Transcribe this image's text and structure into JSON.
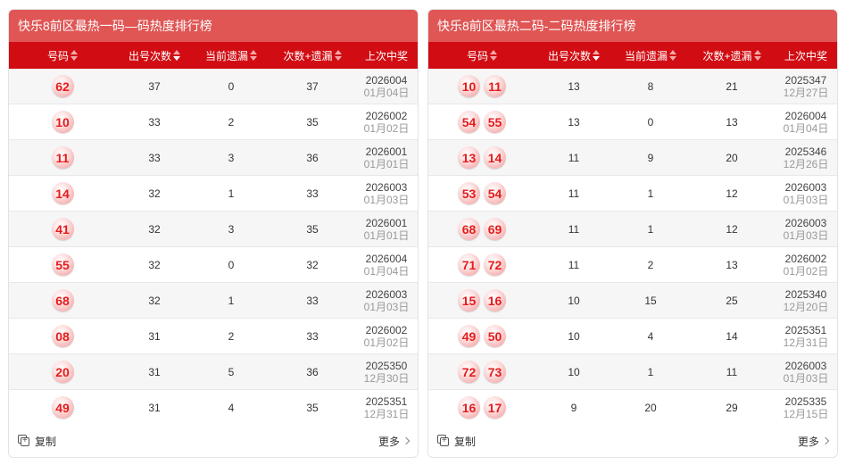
{
  "panels": [
    {
      "title": "快乐8前区最热一码—码热度排行榜",
      "headers": {
        "number": "号码",
        "count": "出号次数",
        "miss": "当前遗漏",
        "sum": "次数+遗漏",
        "last": "上次中奖"
      },
      "rows": [
        {
          "balls": [
            "62"
          ],
          "count": "37",
          "miss": "0",
          "sum": "37",
          "period": "2026004",
          "date": "01月04日"
        },
        {
          "balls": [
            "10"
          ],
          "count": "33",
          "miss": "2",
          "sum": "35",
          "period": "2026002",
          "date": "01月02日"
        },
        {
          "balls": [
            "11"
          ],
          "count": "33",
          "miss": "3",
          "sum": "36",
          "period": "2026001",
          "date": "01月01日"
        },
        {
          "balls": [
            "14"
          ],
          "count": "32",
          "miss": "1",
          "sum": "33",
          "period": "2026003",
          "date": "01月03日"
        },
        {
          "balls": [
            "41"
          ],
          "count": "32",
          "miss": "3",
          "sum": "35",
          "period": "2026001",
          "date": "01月01日"
        },
        {
          "balls": [
            "55"
          ],
          "count": "32",
          "miss": "0",
          "sum": "32",
          "period": "2026004",
          "date": "01月04日"
        },
        {
          "balls": [
            "68"
          ],
          "count": "32",
          "miss": "1",
          "sum": "33",
          "period": "2026003",
          "date": "01月03日"
        },
        {
          "balls": [
            "08"
          ],
          "count": "31",
          "miss": "2",
          "sum": "33",
          "period": "2026002",
          "date": "01月02日"
        },
        {
          "balls": [
            "20"
          ],
          "count": "31",
          "miss": "5",
          "sum": "36",
          "period": "2025350",
          "date": "12月30日"
        },
        {
          "balls": [
            "49"
          ],
          "count": "31",
          "miss": "4",
          "sum": "35",
          "period": "2025351",
          "date": "12月31日"
        }
      ],
      "footer": {
        "copy": "复制",
        "more": "更多"
      }
    },
    {
      "title": "快乐8前区最热二码-二码热度排行榜",
      "headers": {
        "number": "号码",
        "count": "出号次数",
        "miss": "当前遗漏",
        "sum": "次数+遗漏",
        "last": "上次中奖"
      },
      "rows": [
        {
          "balls": [
            "10",
            "11"
          ],
          "count": "13",
          "miss": "8",
          "sum": "21",
          "period": "2025347",
          "date": "12月27日"
        },
        {
          "balls": [
            "54",
            "55"
          ],
          "count": "13",
          "miss": "0",
          "sum": "13",
          "period": "2026004",
          "date": "01月04日"
        },
        {
          "balls": [
            "13",
            "14"
          ],
          "count": "11",
          "miss": "9",
          "sum": "20",
          "period": "2025346",
          "date": "12月26日"
        },
        {
          "balls": [
            "53",
            "54"
          ],
          "count": "11",
          "miss": "1",
          "sum": "12",
          "period": "2026003",
          "date": "01月03日"
        },
        {
          "balls": [
            "68",
            "69"
          ],
          "count": "11",
          "miss": "1",
          "sum": "12",
          "period": "2026003",
          "date": "01月03日"
        },
        {
          "balls": [
            "71",
            "72"
          ],
          "count": "11",
          "miss": "2",
          "sum": "13",
          "period": "2026002",
          "date": "01月02日"
        },
        {
          "balls": [
            "15",
            "16"
          ],
          "count": "10",
          "miss": "15",
          "sum": "25",
          "period": "2025340",
          "date": "12月20日"
        },
        {
          "balls": [
            "49",
            "50"
          ],
          "count": "10",
          "miss": "4",
          "sum": "14",
          "period": "2025351",
          "date": "12月31日"
        },
        {
          "balls": [
            "72",
            "73"
          ],
          "count": "10",
          "miss": "1",
          "sum": "11",
          "period": "2026003",
          "date": "01月03日"
        },
        {
          "balls": [
            "16",
            "17"
          ],
          "count": "9",
          "miss": "20",
          "sum": "29",
          "period": "2025335",
          "date": "12月15日"
        }
      ],
      "footer": {
        "copy": "复制",
        "more": "更多"
      }
    }
  ],
  "colors": {
    "title_bg": "#df5655",
    "header_bg": "#d10d13",
    "ball_text": "#e51c1c"
  },
  "icons": {
    "copy": "copy-icon",
    "more": "chevron-right-icon",
    "sort": "sort-icon"
  }
}
